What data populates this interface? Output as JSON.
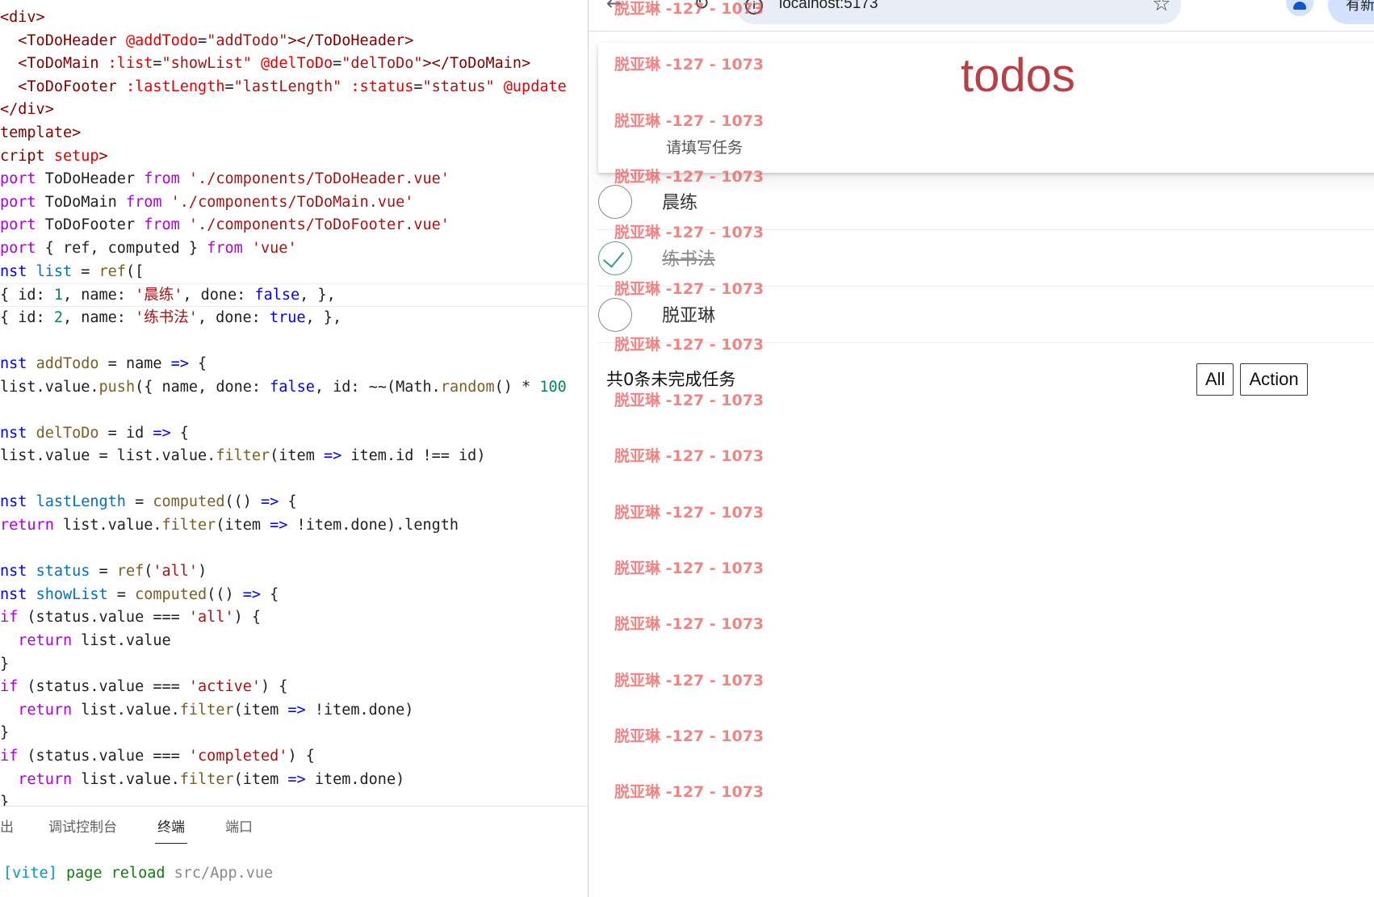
{
  "editor": {
    "lines": [
      [
        [
          "t",
          "<div>"
        ]
      ],
      [
        [
          "o",
          "  "
        ],
        [
          "t",
          "<ToDoHeader"
        ],
        [
          "o",
          " "
        ],
        [
          "a",
          "@addTodo"
        ],
        [
          "o",
          "="
        ],
        [
          "s",
          "\"addTodo\""
        ],
        [
          "t",
          "></ToDoHeader>"
        ]
      ],
      [
        [
          "o",
          "  "
        ],
        [
          "t",
          "<ToDoMain"
        ],
        [
          "o",
          " "
        ],
        [
          "a",
          ":list"
        ],
        [
          "o",
          "="
        ],
        [
          "s",
          "\"showList\""
        ],
        [
          "o",
          " "
        ],
        [
          "a",
          "@delToDo"
        ],
        [
          "o",
          "="
        ],
        [
          "s",
          "\"delToDo\""
        ],
        [
          "t",
          "></ToDoMain>"
        ]
      ],
      [
        [
          "o",
          "  "
        ],
        [
          "t",
          "<ToDoFooter"
        ],
        [
          "o",
          " "
        ],
        [
          "a",
          ":lastLength"
        ],
        [
          "o",
          "="
        ],
        [
          "s",
          "\"lastLength\""
        ],
        [
          "o",
          " "
        ],
        [
          "a",
          ":status"
        ],
        [
          "o",
          "="
        ],
        [
          "s",
          "\"status\""
        ],
        [
          "o",
          " "
        ],
        [
          "a",
          "@update"
        ]
      ],
      [
        [
          "t",
          "</div>"
        ]
      ],
      [
        [
          "t",
          "template>"
        ]
      ],
      [
        [
          "t",
          "cript"
        ],
        [
          "o",
          " "
        ],
        [
          "a",
          "setup"
        ],
        [
          "t",
          ">"
        ]
      ],
      [
        [
          "kw",
          "port"
        ],
        [
          "o",
          " ToDoHeader "
        ],
        [
          "kw",
          "from"
        ],
        [
          "o",
          " "
        ],
        [
          "s",
          "'./components/ToDoHeader.vue'"
        ]
      ],
      [
        [
          "kw",
          "port"
        ],
        [
          "o",
          " ToDoMain "
        ],
        [
          "kw",
          "from"
        ],
        [
          "o",
          " "
        ],
        [
          "s",
          "'./components/ToDoMain.vue'"
        ]
      ],
      [
        [
          "kw",
          "port"
        ],
        [
          "o",
          " ToDoFooter "
        ],
        [
          "kw",
          "from"
        ],
        [
          "o",
          " "
        ],
        [
          "s",
          "'./components/ToDoFooter.vue'"
        ]
      ],
      [
        [
          "kw",
          "port"
        ],
        [
          "o",
          " { ref, computed } "
        ],
        [
          "kw",
          "from"
        ],
        [
          "o",
          " "
        ],
        [
          "s",
          "'vue'"
        ]
      ],
      [
        [
          "k",
          "nst"
        ],
        [
          "o",
          " "
        ],
        [
          "v",
          "list"
        ],
        [
          "o",
          " = "
        ],
        [
          "f",
          "ref"
        ],
        [
          "o",
          "(["
        ]
      ],
      [
        [
          "o",
          "{ id: "
        ],
        [
          "n",
          "1"
        ],
        [
          "o",
          ", name: "
        ],
        [
          "s",
          "'晨练'"
        ],
        [
          "o",
          ", done: "
        ],
        [
          "k",
          "false"
        ],
        [
          "o",
          ", },"
        ]
      ],
      [
        [
          "o",
          "{ id: "
        ],
        [
          "n",
          "2"
        ],
        [
          "o",
          ", name: "
        ],
        [
          "s",
          "'练书法'"
        ],
        [
          "o",
          ", done: "
        ],
        [
          "k",
          "true"
        ],
        [
          "o",
          ", },"
        ]
      ],
      [
        [
          "o",
          ""
        ]
      ],
      [
        [
          "k",
          "nst"
        ],
        [
          "o",
          " "
        ],
        [
          "f",
          "addTodo"
        ],
        [
          "o",
          " = name "
        ],
        [
          "k",
          "=>"
        ],
        [
          "o",
          " {"
        ]
      ],
      [
        [
          "o",
          "list.value."
        ],
        [
          "f",
          "push"
        ],
        [
          "o",
          "({ name, done: "
        ],
        [
          "k",
          "false"
        ],
        [
          "o",
          ", id: ~~(Math."
        ],
        [
          "f",
          "random"
        ],
        [
          "o",
          "() * "
        ],
        [
          "n",
          "100"
        ]
      ],
      [
        [
          "o",
          ""
        ]
      ],
      [
        [
          "k",
          "nst"
        ],
        [
          "o",
          " "
        ],
        [
          "f",
          "delToDo"
        ],
        [
          "o",
          " = id "
        ],
        [
          "k",
          "=>"
        ],
        [
          "o",
          " {"
        ]
      ],
      [
        [
          "o",
          "list.value = list.value."
        ],
        [
          "f",
          "filter"
        ],
        [
          "o",
          "(item "
        ],
        [
          "k",
          "=>"
        ],
        [
          "o",
          " item.id !== id)"
        ]
      ],
      [
        [
          "o",
          ""
        ]
      ],
      [
        [
          "k",
          "nst"
        ],
        [
          "o",
          " "
        ],
        [
          "v",
          "lastLength"
        ],
        [
          "o",
          " = "
        ],
        [
          "f",
          "computed"
        ],
        [
          "o",
          "(() "
        ],
        [
          "k",
          "=>"
        ],
        [
          "o",
          " {"
        ]
      ],
      [
        [
          "kw",
          "return"
        ],
        [
          "o",
          " list.value."
        ],
        [
          "f",
          "filter"
        ],
        [
          "o",
          "(item "
        ],
        [
          "k",
          "=>"
        ],
        [
          "o",
          " !item.done).length"
        ]
      ],
      [
        [
          "o",
          ""
        ]
      ],
      [
        [
          "k",
          "nst"
        ],
        [
          "o",
          " "
        ],
        [
          "v",
          "status"
        ],
        [
          "o",
          " = "
        ],
        [
          "f",
          "ref"
        ],
        [
          "o",
          "("
        ],
        [
          "s",
          "'all'"
        ],
        [
          "o",
          ")"
        ]
      ],
      [
        [
          "k",
          "nst"
        ],
        [
          "o",
          " "
        ],
        [
          "v",
          "showList"
        ],
        [
          "o",
          " = "
        ],
        [
          "f",
          "computed"
        ],
        [
          "o",
          "(() "
        ],
        [
          "k",
          "=>"
        ],
        [
          "o",
          " {"
        ]
      ],
      [
        [
          "kw",
          "if"
        ],
        [
          "o",
          " (status.value === "
        ],
        [
          "s",
          "'all'"
        ],
        [
          "o",
          ") {"
        ]
      ],
      [
        [
          "o",
          "  "
        ],
        [
          "kw",
          "return"
        ],
        [
          "o",
          " list.value"
        ]
      ],
      [
        [
          "o",
          "}"
        ]
      ],
      [
        [
          "kw",
          "if"
        ],
        [
          "o",
          " (status.value === "
        ],
        [
          "s",
          "'active'"
        ],
        [
          "o",
          ") {"
        ]
      ],
      [
        [
          "o",
          "  "
        ],
        [
          "kw",
          "return"
        ],
        [
          "o",
          " list.value."
        ],
        [
          "f",
          "filter"
        ],
        [
          "o",
          "(item "
        ],
        [
          "k",
          "=>"
        ],
        [
          "o",
          " !item.done)"
        ]
      ],
      [
        [
          "o",
          "}"
        ]
      ],
      [
        [
          "kw",
          "if"
        ],
        [
          "o",
          " (status.value === "
        ],
        [
          "s",
          "'completed'"
        ],
        [
          "o",
          ") {"
        ]
      ],
      [
        [
          "o",
          "  "
        ],
        [
          "kw",
          "return"
        ],
        [
          "o",
          " list.value."
        ],
        [
          "f",
          "filter"
        ],
        [
          "o",
          "(item "
        ],
        [
          "k",
          "=>"
        ],
        [
          "o",
          " item.done)"
        ]
      ],
      [
        [
          "o",
          "}"
        ]
      ]
    ],
    "current_line": 12
  },
  "panel": {
    "tabs": [
      "出",
      "调试控制台",
      "终端",
      "端口"
    ],
    "active_tab": 2,
    "terminal": {
      "tag": "[vite]",
      "message": "page reload",
      "path": "src/App.vue"
    }
  },
  "browser": {
    "url": "localhost:5173",
    "update_button": "有新版"
  },
  "todo": {
    "title": "todos",
    "input_placeholder": "请填写任务",
    "items": [
      {
        "name": "晨练",
        "done": false
      },
      {
        "name": "练书法",
        "done": true
      },
      {
        "name": "脱亚琳",
        "done": false
      }
    ],
    "footer": {
      "count_prefix": "共",
      "count": "0",
      "count_suffix": "条未完成任务",
      "filters": [
        "All",
        "Action"
      ]
    }
  },
  "watermark": {
    "text": "脱亚琳 -127 - 1073"
  },
  "colors": {
    "title": "#b83f45",
    "watermark": "#e85858",
    "check": "#3d9a84"
  }
}
